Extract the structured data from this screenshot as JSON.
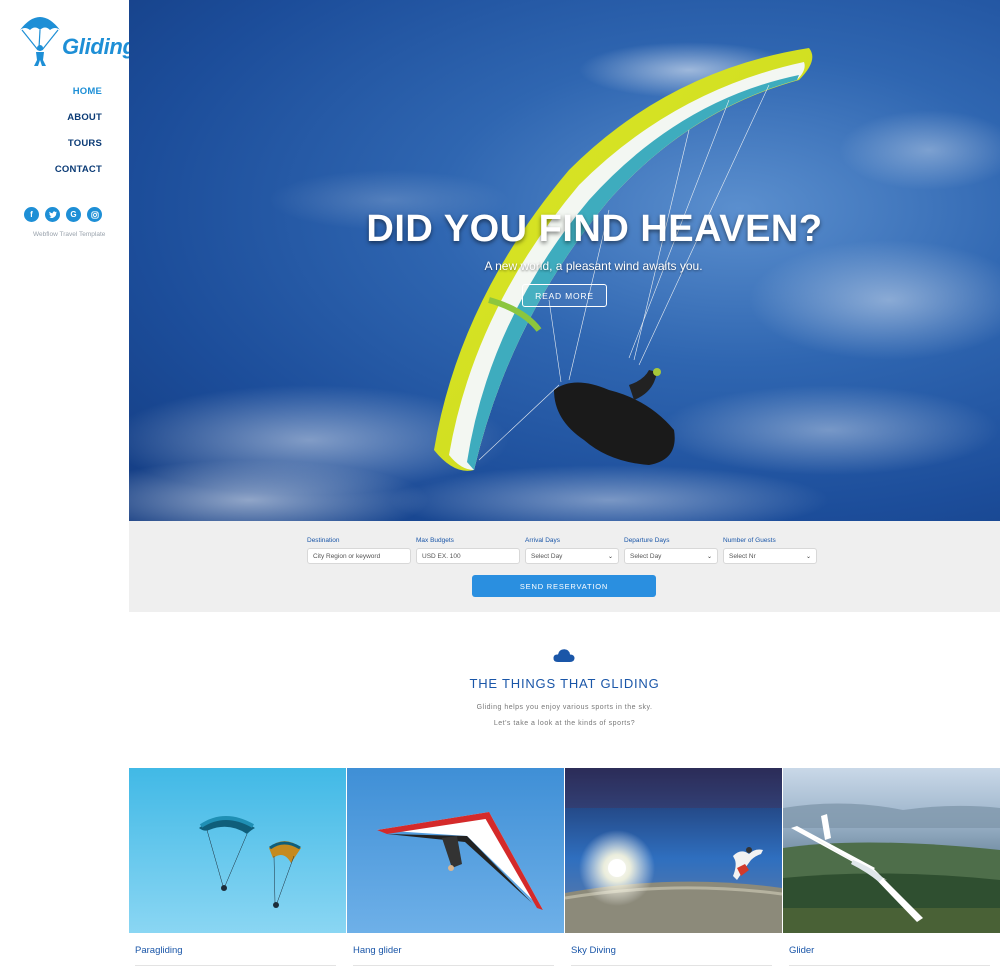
{
  "brand": {
    "name": "Gliding"
  },
  "nav": [
    {
      "label": "HOME",
      "active": true
    },
    {
      "label": "ABOUT",
      "active": false
    },
    {
      "label": "TOURS",
      "active": false
    },
    {
      "label": "CONTACT",
      "active": false
    }
  ],
  "social": [
    {
      "icon": "facebook-icon",
      "glyph": "f"
    },
    {
      "icon": "twitter-icon",
      "glyph": "t"
    },
    {
      "icon": "google-icon",
      "glyph": "G"
    },
    {
      "icon": "instagram-icon",
      "glyph": "◎"
    }
  ],
  "sidebar_note": "Webflow Travel Template",
  "hero": {
    "title": "DID YOU FIND HEAVEN?",
    "subtitle": "A new world, a pleasant wind awaits you.",
    "button": "READ MORE"
  },
  "reservation": {
    "fields": [
      {
        "label": "Destination",
        "placeholder": "City Region or keyword",
        "type": "input"
      },
      {
        "label": "Max Budgets",
        "placeholder": "USD EX. 100",
        "type": "input"
      },
      {
        "label": "Arrival Days",
        "value": "Select Day",
        "type": "select"
      },
      {
        "label": "Departure Days",
        "value": "Select Day",
        "type": "select"
      },
      {
        "label": "Number of Guests",
        "value": "Select Nr",
        "type": "select"
      }
    ],
    "submit": "SEND RESERVATION"
  },
  "section": {
    "icon": "cloud-icon",
    "title": "THE THINGS THAT GLIDING",
    "line1": "Gliding helps you enjoy various sports in the sky.",
    "line2": "Let's take a look at the kinds of sports?"
  },
  "cards": [
    {
      "label": "Paragliding"
    },
    {
      "label": "Hang glider"
    },
    {
      "label": "Sky Diving"
    },
    {
      "label": "Glider"
    }
  ],
  "colors": {
    "accent": "#1e8fd6",
    "nav_text": "#0b3b76",
    "section_title": "#1a56a8",
    "button": "#2a8fe0",
    "reservation_bg": "#efefef"
  }
}
